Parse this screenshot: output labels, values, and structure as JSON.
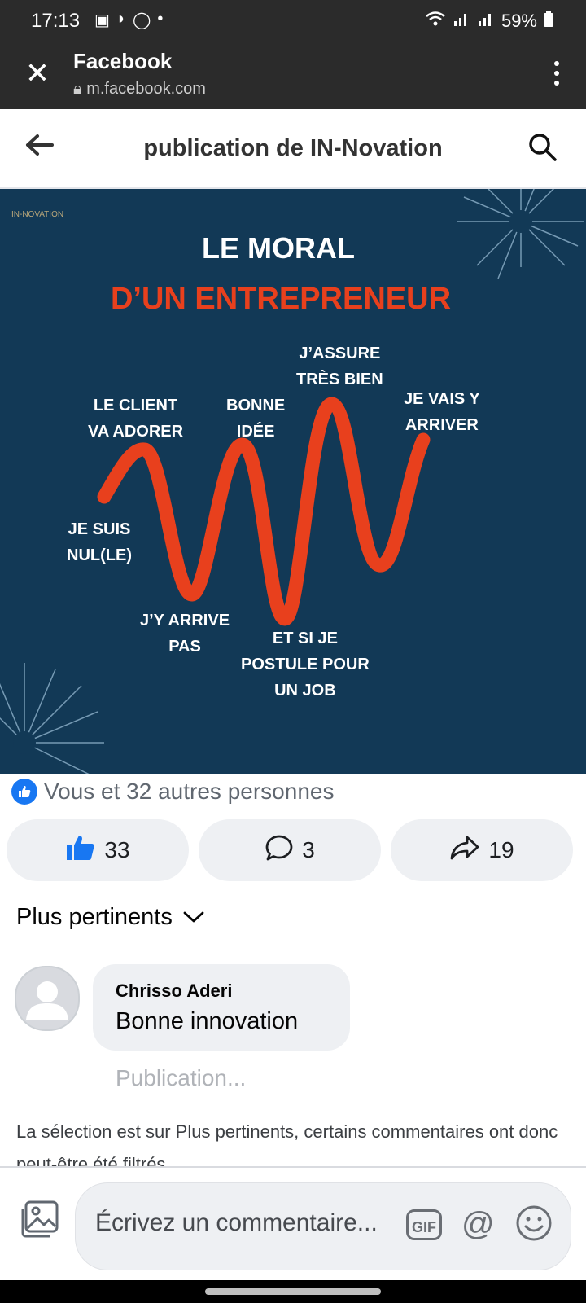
{
  "status_bar": {
    "time": "17:13",
    "battery": "59%",
    "left_icons": [
      "gallery-icon",
      "cast-icon",
      "whatsapp-icon",
      "dot-icon"
    ],
    "right_icons": [
      "wifi-icon",
      "signal-icon",
      "signal-icon",
      "battery-icon"
    ]
  },
  "browser": {
    "title": "Facebook",
    "url": "m.facebook.com"
  },
  "header": {
    "title": "publication de IN-Novation"
  },
  "post_image": {
    "logo_text": "IN-NOVATION",
    "title_line1": "LE MORAL",
    "title_line2": "D’UN ENTREPRENEUR",
    "labels": {
      "le_client": "LE CLIENT\nVA ADORER",
      "bonne_idee": "BONNE\nIDÉE",
      "jassure": "J’ASSURE\nTRÈS BIEN",
      "je_vais": "JE VAIS Y\nARRIVER",
      "je_suis_nul": "JE SUIS\nNUL(LE)",
      "jy_arrive_pas": "J’Y ARRIVE\nPAS",
      "et_si": "ET SI JE\nPOSTULE POUR\nUN JOB"
    },
    "colors": {
      "background": "#123956",
      "accent": "#e8401d"
    }
  },
  "reactions": {
    "summary": "Vous et 32 autres personnes",
    "icon": "like-icon"
  },
  "actions": {
    "like_count": "33",
    "comment_count": "3",
    "share_count": "19"
  },
  "comments_section": {
    "sort_label": "Plus pertinents",
    "comments": [
      {
        "author": "Chrisso Aderi",
        "text": "Bonne innovation",
        "status": "Publication..."
      }
    ],
    "notice": "La sélection est sur Plus pertinents, certains commentaires ont donc peut-être été filtrés."
  },
  "composer": {
    "placeholder": "Écrivez un commentaire...",
    "gif_label": "GIF",
    "at_label": "@"
  }
}
